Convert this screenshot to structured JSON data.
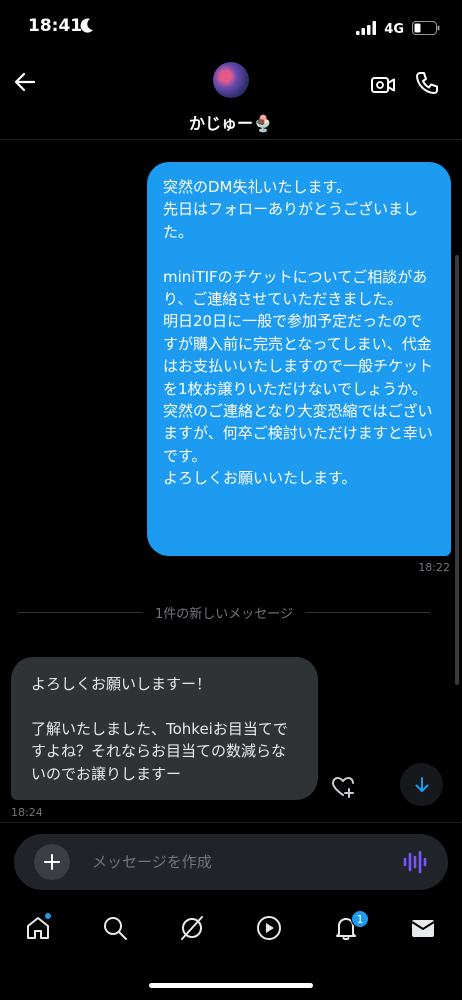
{
  "status_bar": {
    "time": "18:41",
    "network": "4G"
  },
  "header": {
    "contact_name": "かじゅー🍨"
  },
  "messages": {
    "outgoing_text": "突然のDM失礼いたします。\n先日はフォローありがとうございました。\n\nminiTIFのチケットについてご相談があり、ご連絡させていただきました。\n明日20日に一般で参加予定だったのですが購入前に完売となってしまい、代金はお支払いいたしますので一般チケットを1枚お譲りいただけないでしょうか。\n突然のご連絡となり大変恐縮ではございますが、何卒ご検討いただけますと幸いです。\nよろしくお願いいたします。",
    "outgoing_time": "18:22",
    "new_divider": "1件の新しいメッセージ",
    "incoming_text": "よろしくお願いしますー！\n\n了解いたしました、Tohkeiお目当てですよね？それならお目当ての数減らないのでお譲りしますー",
    "incoming_time": "18:24"
  },
  "composer": {
    "placeholder": "メッセージを作成"
  },
  "nav": {
    "notifications_badge": "1"
  },
  "colors": {
    "accent": "#1d9bf0",
    "incoming_bubble": "#2f3336",
    "voice_icon": "#7856ff"
  }
}
